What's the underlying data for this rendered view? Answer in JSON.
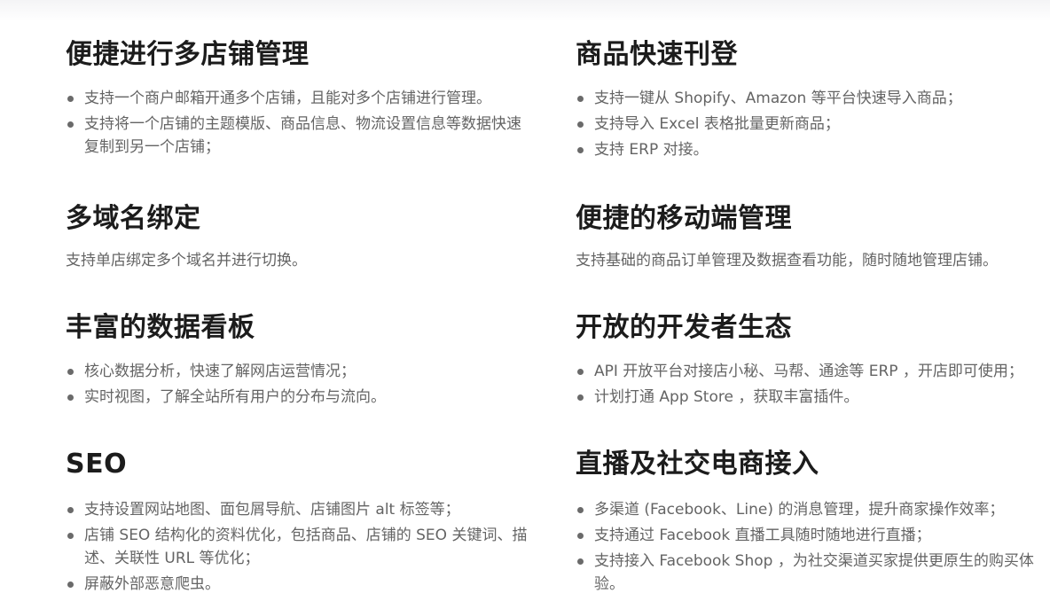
{
  "features": {
    "multistore": {
      "title": "便捷进行多店铺管理",
      "items": [
        "支持一个商户邮箱开通多个店铺，且能对多个店铺进行管理。",
        "支持将一个店铺的主题模版、商品信息、物流设置信息等数据快速复制到另一个店铺；"
      ]
    },
    "listing": {
      "title": "商品快速刊登",
      "items": [
        "支持一键从 Shopify、Amazon 等平台快速导入商品；",
        "支持导入 Excel 表格批量更新商品；",
        "支持 ERP 对接。"
      ]
    },
    "domain": {
      "title": "多域名绑定",
      "text": "支持单店绑定多个域名并进行切换。"
    },
    "mobile": {
      "title": "便捷的移动端管理",
      "text": "支持基础的商品订单管理及数据查看功能，随时随地管理店铺。"
    },
    "dashboard": {
      "title": "丰富的数据看板",
      "items": [
        "核心数据分析，快速了解网店运营情况；",
        "实时视图，了解全站所有用户的分布与流向。"
      ]
    },
    "developer": {
      "title": "开放的开发者生态",
      "items": [
        "API 开放平台对接店小秘、马帮、通途等 ERP ，开店即可使用；",
        "计划打通 App Store ，获取丰富插件。"
      ]
    },
    "seo": {
      "title": "SEO",
      "items": [
        "支持设置网站地图、面包屑导航、店铺图片 alt 标签等；",
        "店铺 SEO 结构化的资料优化，包括商品、店铺的 SEO 关键词、描述、关联性 URL 等优化；",
        "屏蔽外部恶意爬虫。"
      ]
    },
    "live": {
      "title": "直播及社交电商接入",
      "items": [
        "多渠道 (Facebook、Line) 的消息管理，提升商家操作效率；",
        "支持通过 Facebook 直播工具随时随地进行直播；",
        "支持接入 Facebook Shop ，为社交渠道买家提供更原生的购买体验。"
      ]
    }
  }
}
